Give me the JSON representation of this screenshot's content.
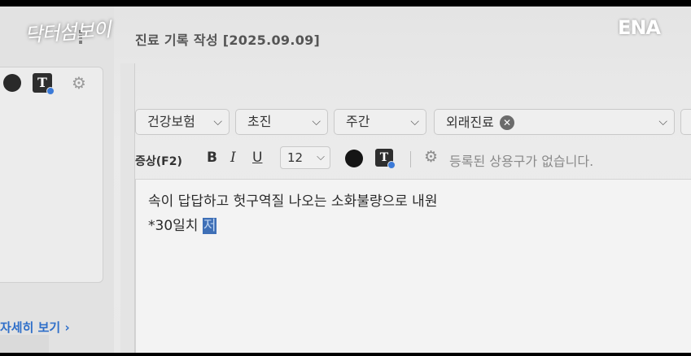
{
  "overlay": {
    "show_logo": "닥터섬보이",
    "channel_logo": "ENA"
  },
  "sidebar": {
    "kebab_glyph": "⋮",
    "detail_link": "자세히 보기 ›",
    "icons": [
      "color-dot-icon",
      "text-style-icon",
      "gear-icon"
    ]
  },
  "header": {
    "title": "진료 기록 작성 [2025.09.09]"
  },
  "dropdowns": {
    "insurance": "건강보험",
    "visit_type": "초진",
    "time": "주간",
    "care_tag": "외래진료",
    "chevron": "⌵",
    "remove_glyph": "✕"
  },
  "toolbar": {
    "section_label": "증상(F2)",
    "bold": "B",
    "italic": "I",
    "underline": "U",
    "font_size": "12",
    "text_style": "T",
    "no_phrases_msg": "등록된 상용구가 없습니다."
  },
  "editor": {
    "line1": "속이 답답하고 헛구역질 나오는 소화불량으로 내원",
    "line2_prefix": "*30일치 ",
    "line2_selected": "저"
  }
}
